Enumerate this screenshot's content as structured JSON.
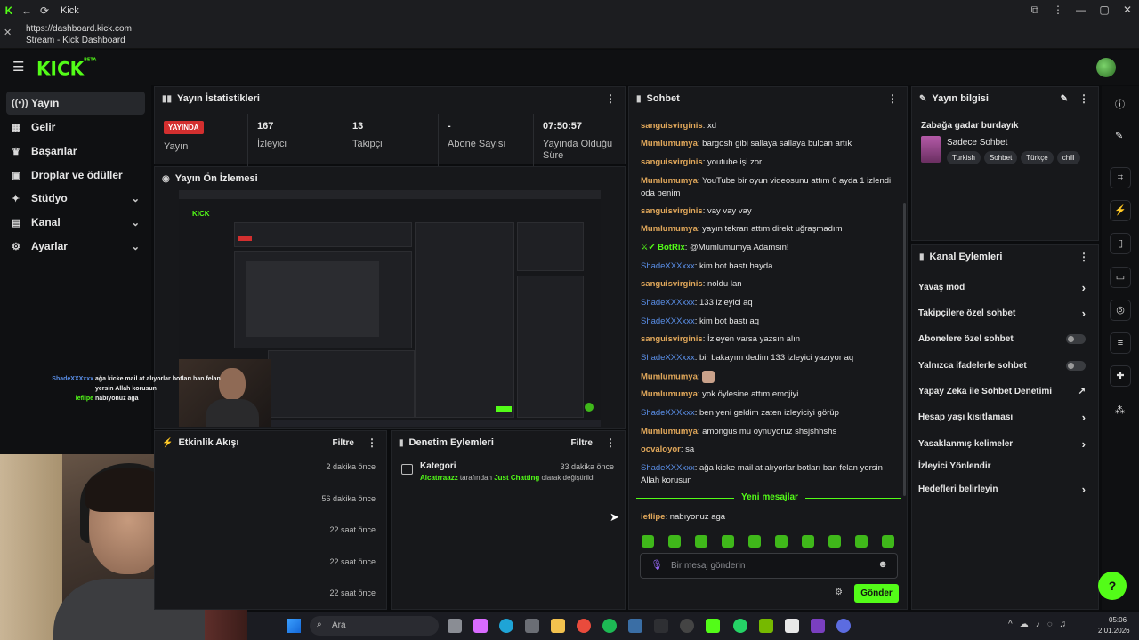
{
  "window": {
    "title": "Kick",
    "url": "https://dashboard.kick.com",
    "page_title": "Stream - Kick Dashboard"
  },
  "brand": {
    "logo": "KICK",
    "logo_sup": "BETA",
    "accent": "#53fc18"
  },
  "sidebar": {
    "items": [
      {
        "label": "Yayın",
        "icon": "stream-icon",
        "active": true,
        "expandable": false
      },
      {
        "label": "Gelir",
        "icon": "dashboard-icon",
        "active": false,
        "expandable": false
      },
      {
        "label": "Başarılar",
        "icon": "trophy-icon",
        "active": false,
        "expandable": false
      },
      {
        "label": "Droplar ve ödüller",
        "icon": "gift-icon",
        "active": false,
        "expandable": false
      },
      {
        "label": "Stüdyo",
        "icon": "studio-icon",
        "active": false,
        "expandable": true
      },
      {
        "label": "Kanal",
        "icon": "channel-icon",
        "active": false,
        "expandable": true
      },
      {
        "label": "Ayarlar",
        "icon": "gear-icon",
        "active": false,
        "expandable": true
      }
    ]
  },
  "stats": {
    "title": "Yayın İstatistikleri",
    "live_badge": "YAYINDA",
    "items": [
      {
        "value": "",
        "label": "Yayın"
      },
      {
        "value": "167",
        "label": "İzleyici"
      },
      {
        "value": "13",
        "label": "Takipçi"
      },
      {
        "value": "-",
        "label": "Abone Sayısı"
      },
      {
        "value": "07:50:57",
        "label": "Yayında Olduğu Süre"
      }
    ]
  },
  "preview": {
    "title": "Yayın Ön İzlemesi"
  },
  "overlay_chat": [
    {
      "user": "ShadeXXXxxx",
      "text": "ağa kicke mail at alıyorlar botları ban felan yersin Allah korusun"
    },
    {
      "user": "ieflipe",
      "text": "nabıyonuz aga"
    }
  ],
  "activity": {
    "title": "Etkinlik Akışı",
    "filter": "Filtre",
    "times": [
      "2 dakika önce",
      "56 dakika önce",
      "22 saat önce",
      "22 saat önce",
      "22 saat önce"
    ]
  },
  "moderation": {
    "title": "Denetim Eylemleri",
    "filter": "Filtre",
    "entry": {
      "title": "Kategori",
      "time": "33 dakika önce",
      "actor": "Alcatrraazz",
      "mid": "tarafından",
      "category": "Just Chatting",
      "suffix": "olarak değiştirildi"
    }
  },
  "chat": {
    "title": "Sohbet",
    "new_messages": "Yeni mesajlar",
    "input_placeholder": "Bir mesaj gönderin",
    "send": "Gönder",
    "messages": [
      {
        "user": "sanguisvirginis",
        "color": "or",
        "text": "xd"
      },
      {
        "user": "Mumlumumya",
        "color": "or",
        "text": "bargosh gibi sallaya sallaya bulcan artık"
      },
      {
        "user": "sanguisvirginis",
        "color": "or",
        "text": "youtube işi zor"
      },
      {
        "user": "Mumlumumya",
        "color": "or",
        "text": "YouTube bir oyun videosunu attım 6 ayda 1 izlendi oda benim"
      },
      {
        "user": "sanguisvirginis",
        "color": "or",
        "text": "vay vay vay"
      },
      {
        "user": "Mumlumumya",
        "color": "or",
        "text": "yayın tekrarı attım direkt uğraşmadım"
      },
      {
        "user": "BotRix",
        "color": "gr",
        "text": "@Mumlumumya Adamsın!"
      },
      {
        "user": "ShadeXXXxxx",
        "color": "bl",
        "text": "kim bot bastı hayda"
      },
      {
        "user": "sanguisvirginis",
        "color": "or",
        "text": "noldu lan"
      },
      {
        "user": "ShadeXXXxxx",
        "color": "bl",
        "text": "133 izleyici aq"
      },
      {
        "user": "ShadeXXXxxx",
        "color": "bl",
        "text": "kim bot bastı aq"
      },
      {
        "user": "sanguisvirginis",
        "color": "or",
        "text": "İzleyen varsa yazsın alın"
      },
      {
        "user": "ShadeXXXxxx",
        "color": "bl",
        "text": "bir bakayım dedim 133 izleyici yazıyor aq"
      },
      {
        "user": "Mumlumumya",
        "color": "or",
        "text": ""
      },
      {
        "user": "Mumlumumya",
        "color": "or",
        "text": "yok öylesine attım emojiyi"
      },
      {
        "user": "ShadeXXXxxx",
        "color": "bl",
        "text": "ben yeni geldim zaten izleyiciyi görüp"
      },
      {
        "user": "Mumlumumya",
        "color": "or",
        "text": "amongus mu oynuyoruz shsjshhshs"
      },
      {
        "user": "ocvaloyor",
        "color": "or",
        "text": "sa"
      },
      {
        "user": "ShadeXXXxxx",
        "color": "bl",
        "text": "ağa kicke mail at alıyorlar botları ban felan yersin Allah korusun"
      },
      {
        "user": "ieflipe",
        "color": "or",
        "text": "nabıyonuz aga"
      }
    ]
  },
  "stream_info": {
    "title": "Yayın bilgisi",
    "stream_title": "Zabağa gadar burdayık",
    "category": "Sadece Sohbet",
    "tags": [
      "Turkish",
      "Sohbet",
      "Türkçe",
      "chill"
    ]
  },
  "channel_actions": {
    "title": "Kanal Eylemleri",
    "items": [
      {
        "label": "Yavaş mod",
        "control": "chevron"
      },
      {
        "label": "Takipçilere özel sohbet",
        "control": "chevron"
      },
      {
        "label": "Abonelere özel sohbet",
        "control": "toggle"
      },
      {
        "label": "Yalnızca ifadelerle sohbet",
        "control": "toggle"
      },
      {
        "label": "Yapay Zeka ile Sohbet Denetimi",
        "control": "external"
      },
      {
        "label": "Hesap yaşı kısıtlaması",
        "control": "chevron"
      },
      {
        "label": "Yasaklanmış kelimeler",
        "control": "chevron"
      },
      {
        "label": "İzleyici Yönlendir",
        "control": "none"
      },
      {
        "label": "Hedefleri belirleyin",
        "control": "chevron"
      }
    ]
  },
  "taskbar": {
    "search": "Ara",
    "time": "05:06",
    "date": "2.01.2026"
  }
}
